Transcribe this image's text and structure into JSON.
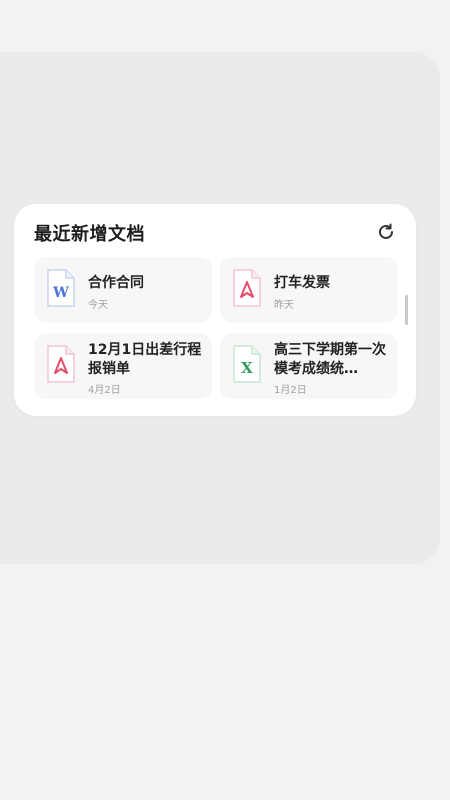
{
  "widget": {
    "title": "最近新增文档",
    "refresh_icon": "refresh-icon"
  },
  "documents": [
    {
      "name": "合作合同",
      "date": "今天",
      "type": "word",
      "icon": "word-doc-icon",
      "color": "#4a74d9"
    },
    {
      "name": "打车发票",
      "date": "昨天",
      "type": "pdf",
      "icon": "pdf-doc-icon",
      "color": "#e44c6b"
    },
    {
      "name": "12月1日出差行程报销单",
      "date": "4月2日",
      "type": "pdf",
      "icon": "pdf-doc-icon",
      "color": "#e44c6b"
    },
    {
      "name": "高三下学期第一次模考成绩统…",
      "date": "1月2日",
      "type": "excel",
      "icon": "excel-doc-icon",
      "color": "#2f9e5b"
    }
  ]
}
